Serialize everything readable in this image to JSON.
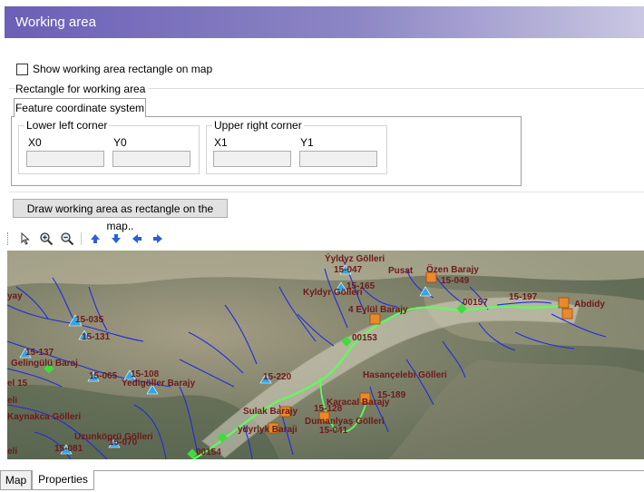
{
  "header": {
    "title": "Working area"
  },
  "checkbox": {
    "label": "Show working area rectangle on map",
    "checked": false
  },
  "rectangle_group": {
    "title": "Rectangle for working area",
    "tab_label": "Feature coordinate system",
    "lower_left": {
      "legend": "Lower left corner",
      "x_label": "X0",
      "y_label": "Y0",
      "x_value": "",
      "y_value": ""
    },
    "upper_right": {
      "legend": "Upper right corner",
      "x_label": "X1",
      "y_label": "Y1",
      "x_value": "",
      "y_value": ""
    }
  },
  "draw_button_label": "Draw working area as rectangle on the map..",
  "toolbar": {
    "buttons": [
      "select-pointer-icon",
      "zoom-in-icon",
      "zoom-out-icon",
      "pan-up-icon",
      "pan-down-icon",
      "pan-left-icon",
      "pan-right-icon"
    ]
  },
  "map": {
    "labels": {
      "yyldyz": "Ýyldyz Gölleri",
      "l15047": "15-047",
      "pusat": "Pusat",
      "ozen": "Özen Barajy",
      "l15049": "15-049",
      "kyldyr": "Kyldyr Gölleri",
      "l15165": "15-165",
      "l15197": "15-197",
      "abdidy": "Abdidy",
      "lefty": "yay",
      "fourlyi": "4 Eylül Barajy",
      "l00153": "00153",
      "l00157": "00157",
      "l15035": "15-035",
      "l15131": "15-131",
      "l15137": "15-137",
      "gelin": "Gelingülü Baraj",
      "el15": "el 15",
      "l15065": "15-065",
      "l15108": "15-108",
      "yedigoller": "Yedigöller Barajy",
      "l15220": "15-220",
      "hasan": "Hasançelebi Gölleri",
      "karacal": "Karacal Barajy",
      "l15189": "15-189",
      "eli": "eli",
      "kaynakca": "Kaynakca Gölleri",
      "sulak": "Sulak Barajy",
      "l15128": "15-128",
      "dumanly": "Dumanlyaş Gölleri",
      "l15041": "15-041",
      "yol": "ydyrlyk Baraji",
      "uzunk": "Uzunköprü Gölleri",
      "l15081": "15-081",
      "l15070": "15-070",
      "l00154": "00154",
      "eli2": "eli"
    },
    "colors": {
      "river": "#1f2be0",
      "path": "#5cff5c",
      "zone": "#d9d6c4",
      "label": "#6e1a1a",
      "station": "#2fa8e8",
      "reservoir": "#e8892b"
    }
  },
  "bottom_tabs": [
    "Map",
    "Properties"
  ]
}
